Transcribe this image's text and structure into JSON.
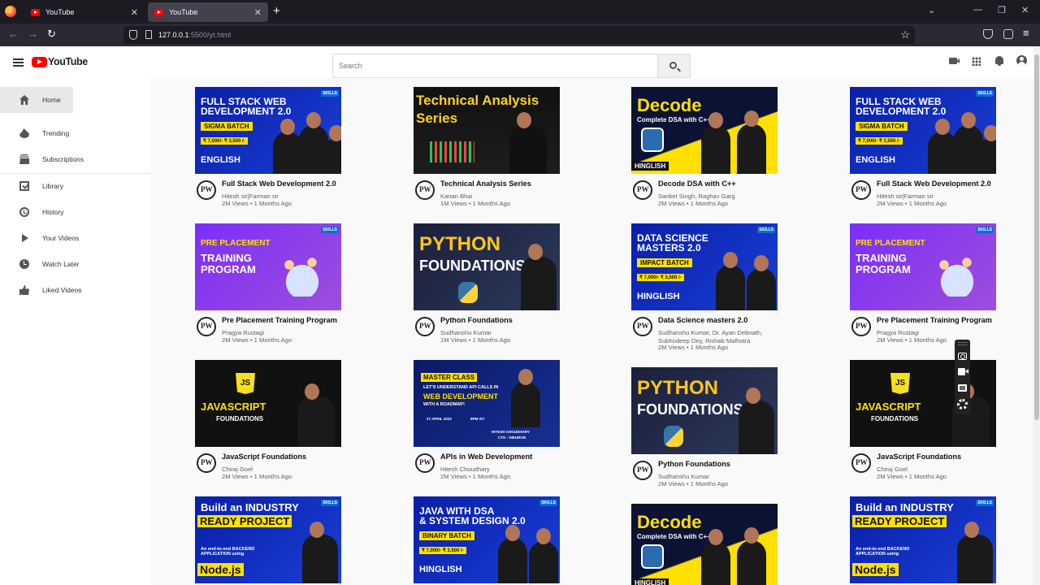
{
  "browser": {
    "tabs": [
      {
        "label": "YouTube",
        "active": false
      },
      {
        "label": "YouTube",
        "active": true
      }
    ],
    "url_host": "127.0.0.1",
    "url_rest": ":5500/yt.html"
  },
  "header": {
    "logo_text": "YouTube",
    "search_placeholder": "Search"
  },
  "sidebar": {
    "items": [
      {
        "label": "Home",
        "icon": "home-icon",
        "active": true
      },
      {
        "label": "Trending",
        "icon": "fire-icon"
      },
      {
        "label": "Subscriptions",
        "icon": "subscriptions-icon"
      },
      {
        "label": "Library",
        "icon": "library-icon"
      },
      {
        "label": "History",
        "icon": "history-icon"
      },
      {
        "label": "Your Videos",
        "icon": "play-icon"
      },
      {
        "label": "Watch Later",
        "icon": "clock-icon"
      },
      {
        "label": "Liked Videos",
        "icon": "thumbs-up-icon"
      }
    ]
  },
  "colors": {
    "brand_red": "#ff0000",
    "pw_blue": "#0a1fa8",
    "pw_yellow": "#ffe000",
    "pw_purple": "#8a2be2"
  },
  "thumbnails": {
    "fullstack": {
      "line1": "FULL STACK WEB",
      "line2": "DEVELOPMENT 2.0",
      "tag": "SIGMA BATCH",
      "price": "₹ 7,000/-  ₹ 3,500 /-",
      "lang": "ENGLISH",
      "badge": "SKILLS"
    },
    "technical": {
      "line1": "Technical Analysis",
      "line2": "Series"
    },
    "decode": {
      "line1": "Decode",
      "line2": "Complete DSA with C++",
      "lang": "HINGLISH"
    },
    "placement": {
      "line1": "PRE PLACEMENT",
      "line2": "TRAINING",
      "line3": "PROGRAM",
      "badge": "SKILLS"
    },
    "python": {
      "line1": "PYTHON",
      "line2": "FOUNDATIONS"
    },
    "datascience": {
      "line1": "DATA SCIENCE",
      "line2": "MASTERS 2.0",
      "tag": "IMPACT BATCH",
      "price": "₹ 7,000/-  ₹ 3,500 /-",
      "lang": "HINGLISH",
      "badge": "SKILLS"
    },
    "javascript": {
      "logo": "JS",
      "line1": "JAVASCRIPT",
      "line2": "FOUNDATIONS"
    },
    "apis": {
      "tag": "MASTER CLASS",
      "line1": "LET'S UNDERSTAND API CALLS IN",
      "line2": "WEB DEVELOPMENT",
      "line3": "WITH A ROADMAP!",
      "date": "27 APRIL 2023",
      "time": "9PM IST",
      "speaker": "HITESH CHOUDHARY",
      "role": "CTO - iNEURON"
    },
    "industry": {
      "line1": "Build an INDUSTRY",
      "line2": "READY PROJECT",
      "line3": "An end-to-end BACKEND APPLICATION using",
      "line4": "Node.js",
      "badge": "SKILLS"
    },
    "javadsa": {
      "line1": "JAVA WITH DSA",
      "line2": "& SYSTEM DESIGN 2.0",
      "tag": "BINARY BATCH",
      "price": "₹ 7,000/-  ₹ 3,500 /-",
      "lang": "HINGLISH",
      "badge": "SKILLS"
    }
  },
  "videos": [
    {
      "title": "Full Stack Web Development 2.0",
      "channel": "Hitesh sir|Farman sir",
      "meta": "2M Views • 1 Months Ago",
      "thumb": "fullstack"
    },
    {
      "title": "Technical Analysis Series",
      "channel": "Kanan Bhai",
      "meta": "1M Views • 1 Months Ago",
      "thumb": "technical"
    },
    {
      "title": "Decode DSA with C++",
      "channel": "Sanket Singh, Raghav Garg",
      "meta": "2M Views • 1 Months Ago",
      "thumb": "decode"
    },
    {
      "title": "Full Stack Web Development 2.0",
      "channel": "Hitesh sir|Farman sir",
      "meta": "2M Views • 1 Months Ago",
      "thumb": "fullstack"
    },
    {
      "title": "Pre Placement Training Program",
      "channel": "Pragya Rustagi",
      "meta": "2M Views • 1 Months Ago",
      "thumb": "placement"
    },
    {
      "title": "Python Foundations",
      "channel": "Sudhanshu Kumar",
      "meta": "1M Views • 1 Months Ago",
      "thumb": "python"
    },
    {
      "title": "Data Science masters 2.0",
      "channel": "Sudhanshu Kumar, Dr. Ayan Debnath, Subhodeep Dey, Rishab Malhotra",
      "meta": "2M Views • 1 Months Ago",
      "thumb": "datascience"
    },
    {
      "title": "Pre Placement Training Program",
      "channel": "Pragya Rustagi",
      "meta": "2M Views • 1 Months Ago",
      "thumb": "placement"
    },
    {
      "title": "JavaScript Foundations",
      "channel": "Chiraj Goel",
      "meta": "2M Views • 1 Months Ago",
      "thumb": "javascript"
    },
    {
      "title": "APIs in Web Development",
      "channel": "Hitesh Choudhary",
      "meta": "2M Views • 1 Months Ago",
      "thumb": "apis"
    },
    {
      "title": "Python Foundations",
      "channel": "Sudhanshu Kumar",
      "meta": "2M Views • 1 Months Ago",
      "thumb": "python"
    },
    {
      "title": "JavaScript Foundations",
      "channel": "Chiraj Goel",
      "meta": "2M Views • 1 Months Ago",
      "thumb": "javascript"
    },
    {
      "title": "",
      "channel": "",
      "meta": "",
      "thumb": "industry"
    },
    {
      "title": "",
      "channel": "",
      "meta": "",
      "thumb": "javadsa"
    },
    {
      "title": "",
      "channel": "",
      "meta": "",
      "thumb": "decode"
    },
    {
      "title": "",
      "channel": "",
      "meta": "",
      "thumb": "industry"
    }
  ],
  "channel_avatar_text": "PW"
}
